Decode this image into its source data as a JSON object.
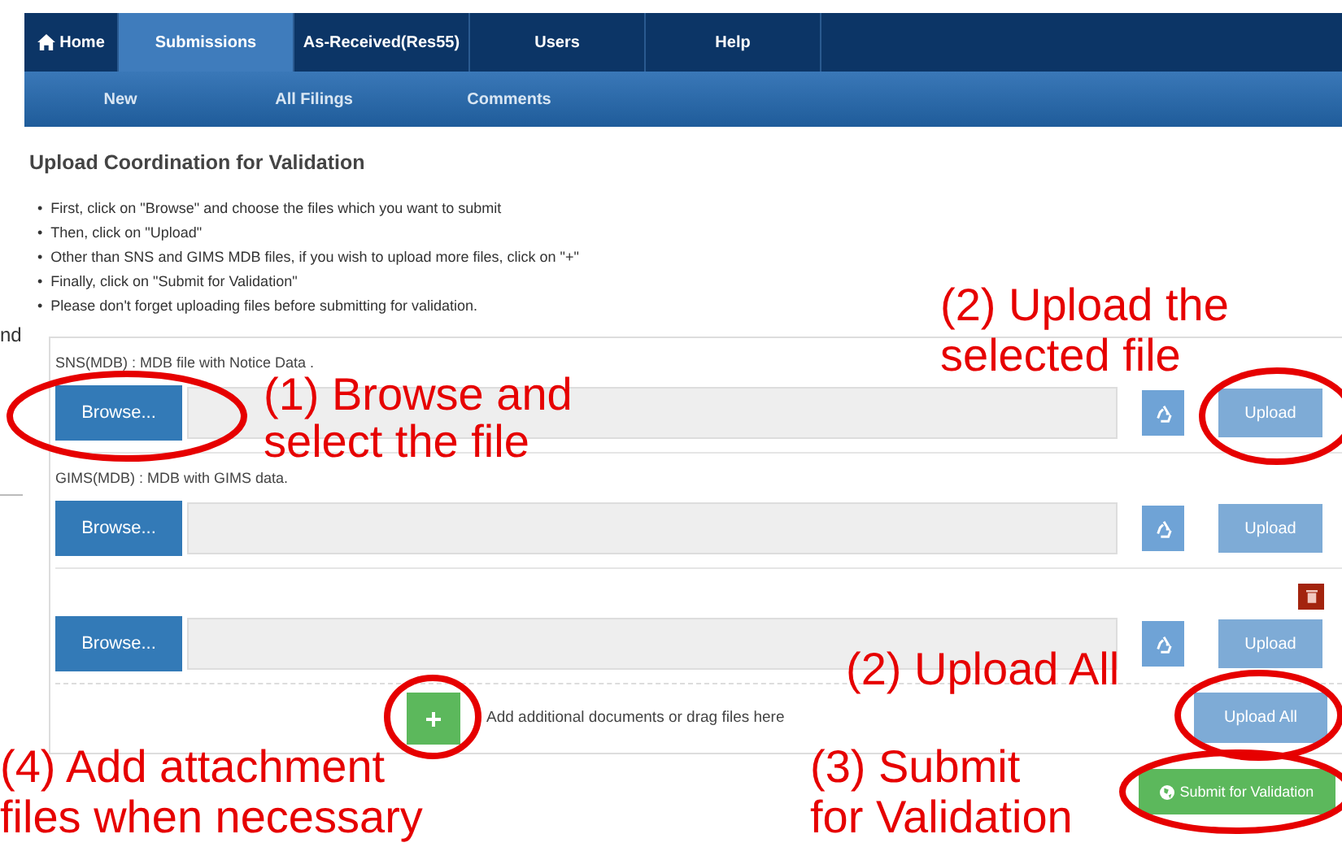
{
  "nav": {
    "tabs": [
      {
        "label": "Home",
        "kind": "home",
        "selected": false
      },
      {
        "label": "Submissions",
        "kind": "text",
        "selected": true
      },
      {
        "label": "As-Received(Res55)",
        "kind": "text",
        "selected": false
      },
      {
        "label": "Users",
        "kind": "text",
        "selected": false
      },
      {
        "label": "Help",
        "kind": "text",
        "selected": false
      }
    ],
    "subtabs": [
      "New",
      "All Filings",
      "Comments"
    ]
  },
  "side_fragment": "nd",
  "title": "Upload Coordination for Validation",
  "instructions": [
    {
      "marker": "•",
      "text": "First, click on \"Browse\" and choose the files which you want to submit"
    },
    {
      "marker": "•",
      "text": "Then, click on \"Upload\""
    },
    {
      "marker": "•",
      "text": "Other than SNS and GIMS MDB files, if you wish to upload more files, click on \"+\""
    },
    {
      "marker": "•",
      "text": "Finally, click on \"Submit for Validation\""
    },
    {
      "marker": "•",
      "text": "Please don't forget uploading files before submitting for validation."
    }
  ],
  "uploads": [
    {
      "label": "SNS(MDB) : MDB file with Notice Data .",
      "browse": "Browse...",
      "upload": "Upload",
      "removable": false
    },
    {
      "label": "GIMS(MDB) : MDB with GIMS data.",
      "browse": "Browse...",
      "upload": "Upload",
      "removable": false
    },
    {
      "browse": "Browse...",
      "upload": "Upload",
      "removable": true
    }
  ],
  "add_text": "Add additional documents or drag files here",
  "upload_all": "Upload All",
  "submit": "Submit for Validation",
  "annotations": [
    {
      "kind": "upload",
      "lines": [
        "(2) Upload the",
        "selected file"
      ]
    },
    {
      "kind": "browse",
      "lines": [
        "(1) Browse and",
        "select the file"
      ]
    },
    {
      "kind": "upload_all",
      "lines": [
        "(2) Upload All"
      ]
    },
    {
      "kind": "attach",
      "lines": [
        "(4) Add attachment",
        "files when necessary"
      ]
    },
    {
      "kind": "submit",
      "lines": [
        "(3) Submit",
        "for Validation"
      ]
    }
  ]
}
